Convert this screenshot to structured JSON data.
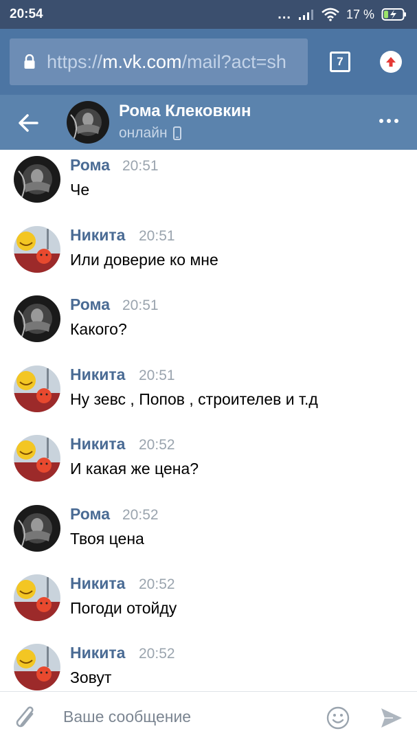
{
  "status_bar": {
    "time": "20:54",
    "more": "...",
    "battery": "17 %"
  },
  "browser": {
    "url_scheme": "https://",
    "url_host": "m.vk.com",
    "url_path": "/mail?act=sh",
    "tabs_count": "7"
  },
  "chat_header": {
    "name": "Рома Клековкин",
    "status": "онлайн"
  },
  "messages": [
    {
      "author": "Рома",
      "time": "20:51",
      "text": "Че"
    },
    {
      "author": "Никита",
      "time": "20:51",
      "text": "Или доверие ко мне"
    },
    {
      "author": "Рома",
      "time": "20:51",
      "text": "Какого?"
    },
    {
      "author": "Никита",
      "time": "20:51",
      "text": "Ну зевс , Попов , строителев и т.д"
    },
    {
      "author": "Никита",
      "time": "20:52",
      "text": "И какая же цена?"
    },
    {
      "author": "Рома",
      "time": "20:52",
      "text": "Твоя цена"
    },
    {
      "author": "Никита",
      "time": "20:52",
      "text": "Погоди отойду"
    },
    {
      "author": "Никита",
      "time": "20:52",
      "text": "Зовут"
    }
  ],
  "composer": {
    "placeholder": "Ваше сообщение"
  },
  "colors": {
    "status_bar": "#3b4f6e",
    "browser_bar": "#4c75a3",
    "chat_header": "#5b83ad",
    "author_name": "#4a6b94",
    "timestamp": "#9aa4ae"
  }
}
